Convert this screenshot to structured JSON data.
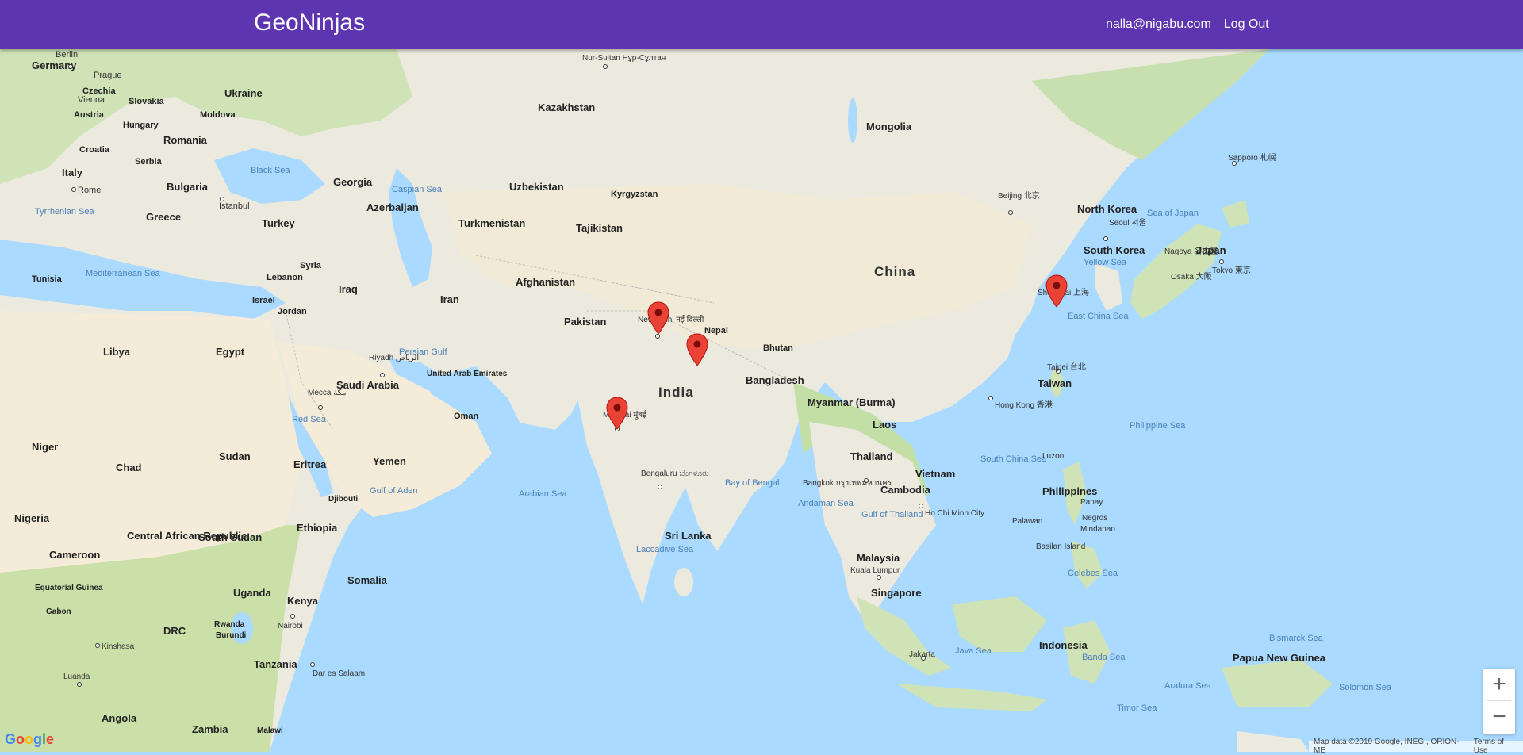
{
  "navbar": {
    "brand": "GeoNinjas",
    "user_email": "nalla@nigabu.com",
    "logout_label": "Log Out"
  },
  "map": {
    "countries": [
      "Germany",
      "Ukraine",
      "Czechia",
      "Slovakia",
      "Austria",
      "Hungary",
      "Moldova",
      "Croatia",
      "Romania",
      "Serbia",
      "Italy",
      "Bulgaria",
      "Greece",
      "Turkey",
      "Georgia",
      "Azerbaijan",
      "Kazakhstan",
      "Mongolia",
      "Uzbekistan",
      "Kyrgyzstan",
      "Turkmenistan",
      "Tajikistan",
      "Afghanistan",
      "Pakistan",
      "Iran",
      "Iraq",
      "Syria",
      "Lebanon",
      "Israel",
      "Jordan",
      "Tunisia",
      "Libya",
      "Egypt",
      "Saudi Arabia",
      "United Arab Emirates",
      "Oman",
      "Yemen",
      "Eritrea",
      "Sudan",
      "Chad",
      "Niger",
      "Nigeria",
      "Ethiopia",
      "South Sudan",
      "Central African Republic",
      "Cameroon",
      "Somalia",
      "Djibouti",
      "Uganda",
      "Kenya",
      "Rwanda",
      "Burundi",
      "DRC",
      "Equatorial Guinea",
      "Gabon",
      "Tanzania",
      "Angola",
      "Zambia",
      "Malawi",
      "India",
      "Nepal",
      "Bhutan",
      "Bangladesh",
      "Myanmar (Burma)",
      "Laos",
      "Thailand",
      "Vietnam",
      "Cambodia",
      "China",
      "North Korea",
      "South Korea",
      "Japan",
      "Taiwan",
      "Philippines",
      "Malaysia",
      "Singapore",
      "Indonesia",
      "Papua New Guinea",
      "Sri Lanka"
    ],
    "seas": [
      "Black Sea",
      "Caspian Sea",
      "Tyrrhenian Sea",
      "Mediterranean Sea",
      "Persian Gulf",
      "Red Sea",
      "Gulf of Aden",
      "Arabian Sea",
      "Bay of Bengal",
      "Laccadive Sea",
      "Andaman Sea",
      "Gulf of Thailand",
      "South China Sea",
      "East China Sea",
      "Yellow Sea",
      "Sea of Japan",
      "Philippine Sea",
      "Celebes Sea",
      "Java Sea",
      "Banda Sea",
      "Arafura Sea",
      "Bismarck Sea",
      "Solomon Sea",
      "Timor Sea"
    ],
    "cities": [
      "Berlin",
      "Prague",
      "Vienna",
      "Rome",
      "Istanbul",
      "Nur-Sultan Нұр-Сұлтан",
      "Riyadh الرياض",
      "Mecca مكة",
      "New Delhi नई दिल्ली",
      "Mumbai मुंबई",
      "Bengaluru ಬೆಂಗಳೂರು",
      "Beijing 北京",
      "Seoul 서울",
      "Nagoya 名古屋",
      "Osaka 大阪",
      "Tokyo 東京",
      "Sapporo 札幌",
      "Shanghai 上海",
      "Taipei 台北",
      "Hong Kong 香港",
      "Bangkok กรุงเทพมหานคร",
      "Ho Chi Minh City",
      "Kuala Lumpur",
      "Jakarta",
      "Nairobi",
      "Kinshasa",
      "Luanda",
      "Dar es Salaam",
      "Panay",
      "Negros",
      "Mindanao",
      "Palawan",
      "Luzon",
      "Basilan Island"
    ],
    "markers": [
      "new-delhi-marker",
      "lucknow-marker",
      "mumbai-marker",
      "shanghai-marker"
    ],
    "zoom_in": "+",
    "zoom_out": "−"
  },
  "footer": {
    "logo": "Google",
    "map_data": "Map data ©2019 Google, INEGI, ORION-ME",
    "terms": "Terms of Use"
  }
}
